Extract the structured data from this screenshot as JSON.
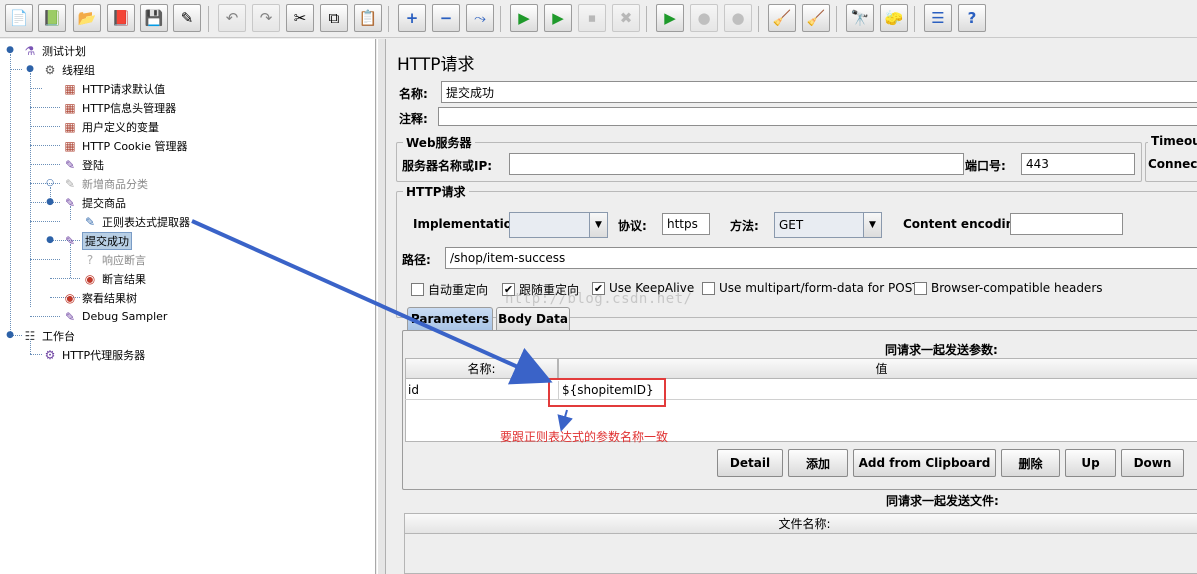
{
  "toolbar": {
    "buttons": [
      {
        "icon": "new-icon",
        "glyph": "📄"
      },
      {
        "icon": "templates-icon",
        "glyph": "📗"
      },
      {
        "icon": "open-icon",
        "glyph": "📂"
      },
      {
        "icon": "close-icon",
        "glyph": "📕"
      },
      {
        "icon": "save-icon",
        "glyph": "💾"
      },
      {
        "icon": "save-as-icon",
        "glyph": "✎"
      },
      {
        "icon": "undo-icon",
        "glyph": "↶"
      },
      {
        "icon": "redo-icon",
        "glyph": "↷"
      },
      {
        "icon": "cut-icon",
        "glyph": "✂"
      },
      {
        "icon": "copy-icon",
        "glyph": "⧉"
      },
      {
        "icon": "paste-icon",
        "glyph": "📋"
      },
      {
        "icon": "expand-icon",
        "glyph": "+"
      },
      {
        "icon": "collapse-icon",
        "glyph": "−"
      },
      {
        "icon": "toggle-icon",
        "glyph": "⤳"
      },
      {
        "icon": "start-icon",
        "glyph": "▶"
      },
      {
        "icon": "start-no-timers-icon",
        "glyph": "▶"
      },
      {
        "icon": "stop-icon",
        "glyph": "⏹"
      },
      {
        "icon": "shutdown-icon",
        "glyph": "✖"
      },
      {
        "icon": "remote-start-icon",
        "glyph": "▶"
      },
      {
        "icon": "remote-stop-icon",
        "glyph": "●"
      },
      {
        "icon": "remote-shutdown-icon",
        "glyph": "●"
      },
      {
        "icon": "clear-icon",
        "glyph": "🧹"
      },
      {
        "icon": "clear-all-icon",
        "glyph": "🧹"
      },
      {
        "icon": "search-icon",
        "glyph": "🔭"
      },
      {
        "icon": "reset-search-icon",
        "glyph": "🧽"
      },
      {
        "icon": "function-helper-icon",
        "glyph": "☰"
      },
      {
        "icon": "help-icon",
        "glyph": "?"
      }
    ]
  },
  "tree": {
    "items": [
      {
        "label": "测试计划",
        "icon": "test-plan-icon",
        "glyph": "⚗"
      },
      {
        "label": "线程组",
        "icon": "thread-group-icon",
        "glyph": "⚙"
      },
      {
        "label": "HTTP请求默认值",
        "icon": "config-element-icon",
        "glyph": "▦"
      },
      {
        "label": "HTTP信息头管理器",
        "icon": "config-element-icon",
        "glyph": "▦"
      },
      {
        "label": "用户定义的变量",
        "icon": "config-element-icon",
        "glyph": "▦"
      },
      {
        "label": "HTTP Cookie 管理器",
        "icon": "config-element-icon",
        "glyph": "▦"
      },
      {
        "label": "登陆",
        "icon": "sampler-icon",
        "glyph": "✎"
      },
      {
        "label": "新增商品分类",
        "icon": "sampler-icon",
        "glyph": "✎"
      },
      {
        "label": "提交商品",
        "icon": "sampler-icon",
        "glyph": "✎"
      },
      {
        "label": "正则表达式提取器",
        "icon": "post-processor-icon",
        "glyph": "✎"
      },
      {
        "label": "提交成功",
        "icon": "sampler-icon",
        "glyph": "✎"
      },
      {
        "label": "响应断言",
        "icon": "assertion-icon",
        "glyph": "?"
      },
      {
        "label": "断言结果",
        "icon": "listener-icon",
        "glyph": "◉"
      },
      {
        "label": "察看结果树",
        "icon": "listener-icon",
        "glyph": "◉"
      },
      {
        "label": "Debug Sampler",
        "icon": "sampler-icon",
        "glyph": "✎"
      },
      {
        "label": "工作台",
        "icon": "workbench-icon",
        "glyph": "☷"
      },
      {
        "label": "HTTP代理服务器",
        "icon": "proxy-icon",
        "glyph": "⚙"
      }
    ]
  },
  "panel": {
    "title": "HTTP请求",
    "name_label": "名称:",
    "name_value": "提交成功",
    "comment_label": "注释:",
    "comment_value": "",
    "web_server": {
      "group_title": "Web服务器",
      "server_label": "服务器名称或IP:",
      "server_value": "",
      "port_label": "端口号:",
      "port_value": "443"
    },
    "timeout": {
      "group_title": "Timeout",
      "connect_label": "Connect:"
    },
    "http_request": {
      "group_title": "HTTP请求",
      "implementation_label": "Implementation:",
      "implementation_value": "",
      "protocol_label": "协议:",
      "protocol_value": "https",
      "method_label": "方法:",
      "method_value": "GET",
      "encoding_label": "Content encoding:",
      "encoding_value": "",
      "path_label": "路径:",
      "path_value": "/shop/item-success"
    },
    "checkboxes": [
      {
        "label": "自动重定向",
        "checked": false,
        "mark": ""
      },
      {
        "label": "跟随重定向",
        "checked": true,
        "mark": "✔"
      },
      {
        "label": "Use KeepAlive",
        "checked": true,
        "mark": "✔"
      },
      {
        "label": "Use multipart/form-data for POST",
        "checked": false,
        "mark": ""
      },
      {
        "label": "Browser-compatible headers",
        "checked": false,
        "mark": ""
      }
    ],
    "tabs": {
      "parameters": "Parameters",
      "body_data": "Body Data"
    },
    "params": {
      "caption": "同请求一起发送参数:",
      "col_name": "名称:",
      "col_value": "值",
      "rows": [
        {
          "name": "id",
          "value": "${shopitemID}"
        }
      ]
    },
    "buttons": {
      "detail": "Detail",
      "add": "添加",
      "add_clipboard": "Add from Clipboard",
      "delete": "删除",
      "up": "Up",
      "down": "Down"
    },
    "files": {
      "caption": "同请求一起发送文件:",
      "col_filename": "文件名称:"
    }
  },
  "annotation": {
    "note": "要跟正则表达式的参数名称一致",
    "watermark": "http://blog.csdn.net/",
    "arrow_color": "#3a63c8",
    "box_color": "#e23b3b"
  }
}
